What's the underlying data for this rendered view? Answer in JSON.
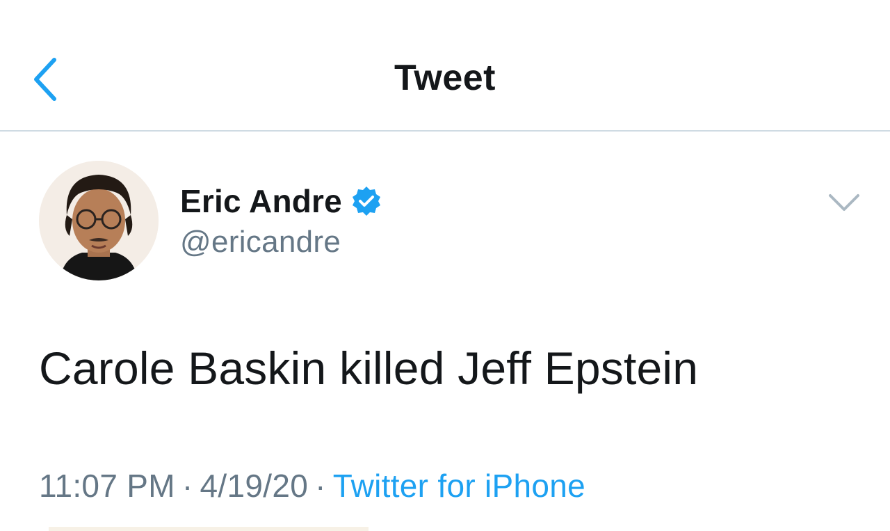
{
  "nav": {
    "title": "Tweet",
    "back_icon": "chevron-left-icon"
  },
  "tweet": {
    "author": {
      "name": "Eric Andre",
      "handle": "@ericandre",
      "verified": true,
      "verified_icon": "verified-badge-icon"
    },
    "menu_icon": "chevron-down-icon",
    "text": "Carole Baskin killed Jeff Epstein",
    "meta": {
      "time": "11:07 PM",
      "separator": "·",
      "date": "4/19/20",
      "source": "Twitter for iPhone"
    }
  },
  "colors": {
    "accent": "#1da1f2",
    "text_primary": "#14171a",
    "text_secondary": "#657786",
    "divider": "#cfdbe3"
  }
}
